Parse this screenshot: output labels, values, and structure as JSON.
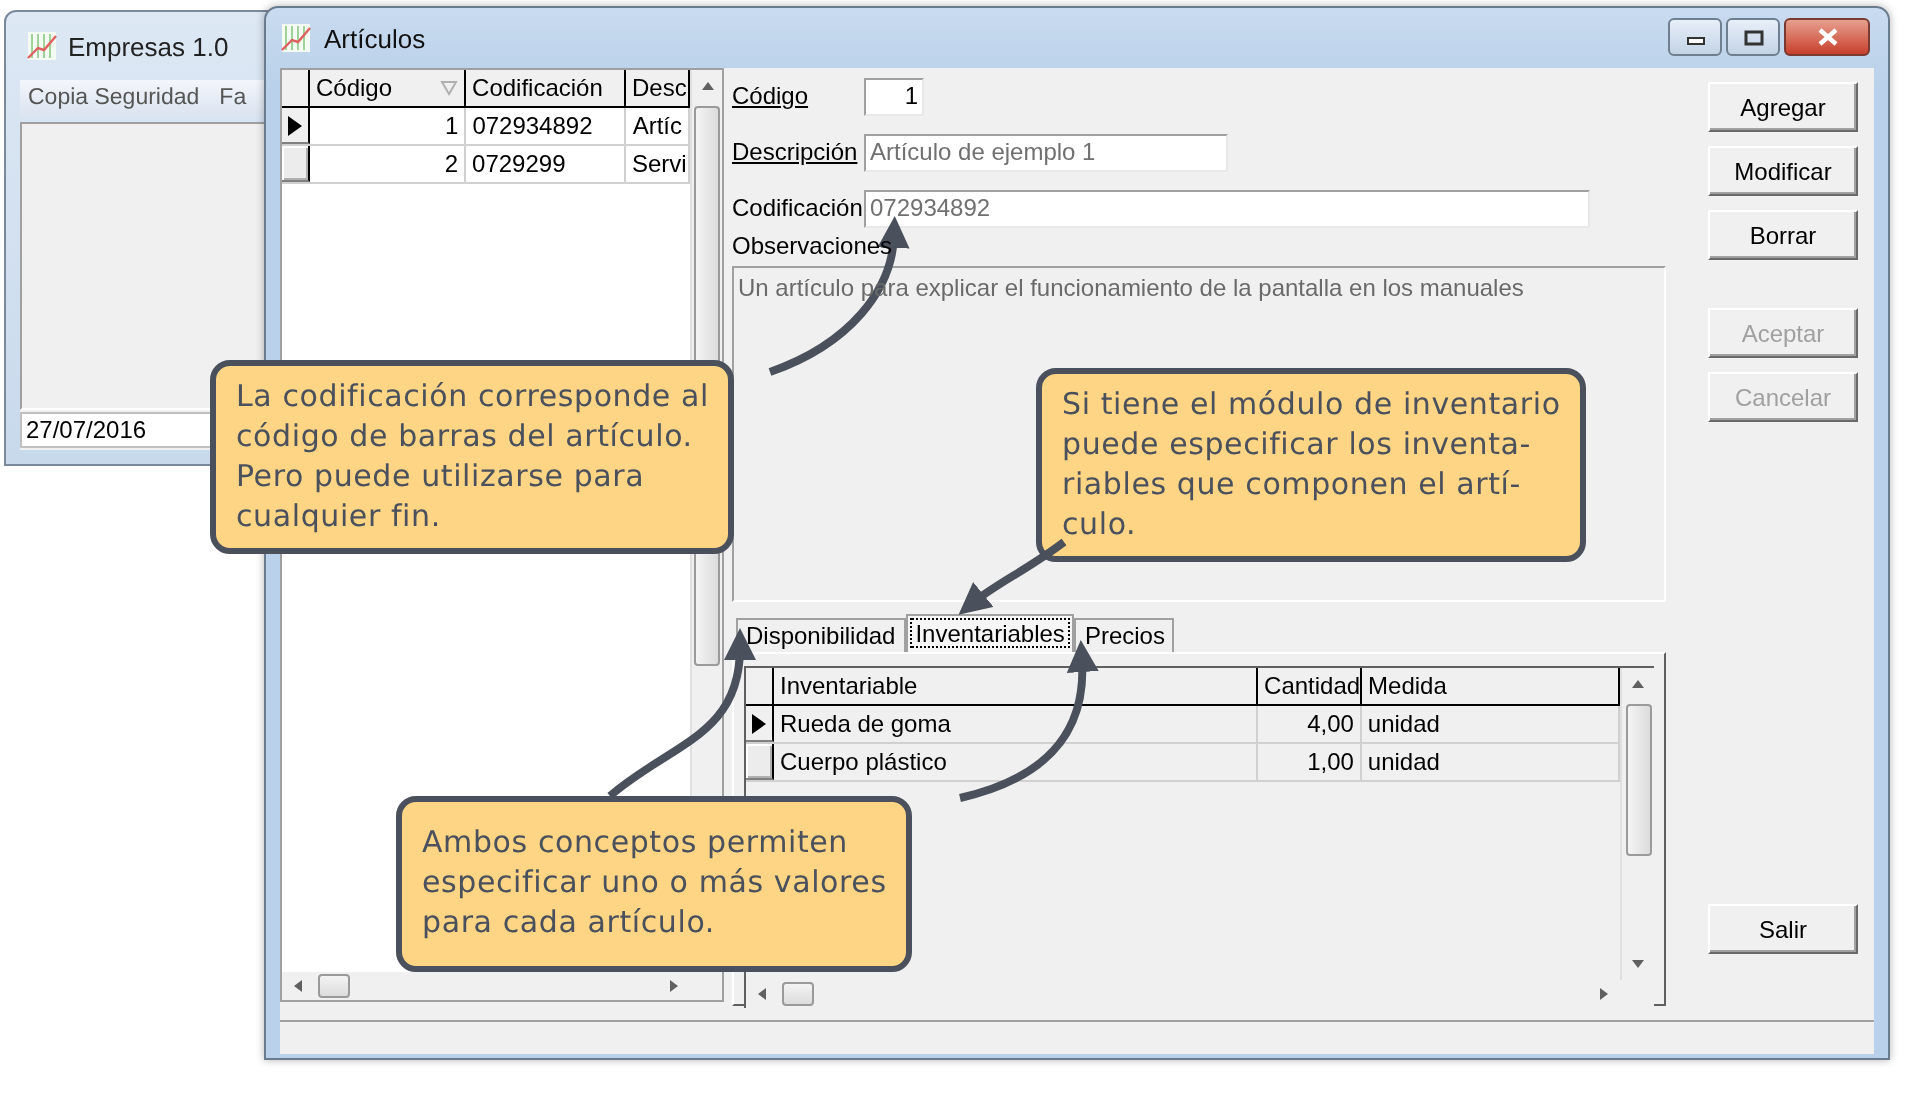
{
  "background_window": {
    "title": "Empresas 1.0",
    "menu": [
      "Copia Seguridad",
      "Fa"
    ],
    "status_bar": "27/07/2016"
  },
  "window": {
    "title": "Artículos",
    "list": {
      "columns": [
        {
          "label": "Código",
          "sorted": true
        },
        {
          "label": "Codificación",
          "sorted": false
        },
        {
          "label": "Desc",
          "sorted": false
        }
      ],
      "rows": [
        {
          "selected": true,
          "cells": [
            "1",
            "072934892",
            "Artíc"
          ]
        },
        {
          "selected": false,
          "cells": [
            "2",
            "0729299",
            "Servi"
          ]
        }
      ]
    },
    "fields": [
      {
        "label": "Código",
        "underlined": true,
        "value": "1",
        "readonly": false,
        "kind": "short"
      },
      {
        "label": "Descripción",
        "underlined": true,
        "value": "Artículo de ejemplo 1",
        "readonly": true,
        "kind": "medium"
      },
      {
        "label": "Codificación",
        "underlined": false,
        "value": "072934892",
        "readonly": true,
        "kind": "long"
      }
    ],
    "notes": {
      "label": "Observaciones",
      "value": "Un artículo para explicar el funcionamiento de la pantalla en los manuales",
      "readonly": true
    },
    "tabs": [
      {
        "label": "Disponibilidad",
        "selected": false
      },
      {
        "label": "Inventariables",
        "selected": true
      },
      {
        "label": "Precios",
        "selected": false
      }
    ],
    "items_table": {
      "columns": [
        "Inventariable",
        "Cantidad",
        "Medida"
      ],
      "rows": [
        {
          "selected": true,
          "cells": [
            "Rueda de goma",
            "4,00",
            "unidad"
          ]
        },
        {
          "selected": false,
          "cells": [
            "Cuerpo plástico",
            "1,00",
            "unidad"
          ]
        }
      ]
    },
    "buttons": [
      {
        "label": "Agregar",
        "disabled": false
      },
      {
        "label": "Modificar",
        "disabled": false
      },
      {
        "label": "Borrar",
        "disabled": false
      },
      {
        "label": "Aceptar",
        "disabled": true
      },
      {
        "label": "Cancelar",
        "disabled": true
      }
    ],
    "exit_button": {
      "label": "Salir",
      "disabled": false
    }
  },
  "callouts": [
    {
      "text": "La codificación corresponde al\ncódigo de barras del artículo.\nPero puede utilizarse para\ncualquier fin."
    },
    {
      "text": "Si tiene el módulo de inventario\npuede especificar los inventa-\nriables que componen el artí-\nculo."
    },
    {
      "text": "Ambos conceptos permiten\nespecificar uno o más valores\npara cada artículo."
    }
  ]
}
